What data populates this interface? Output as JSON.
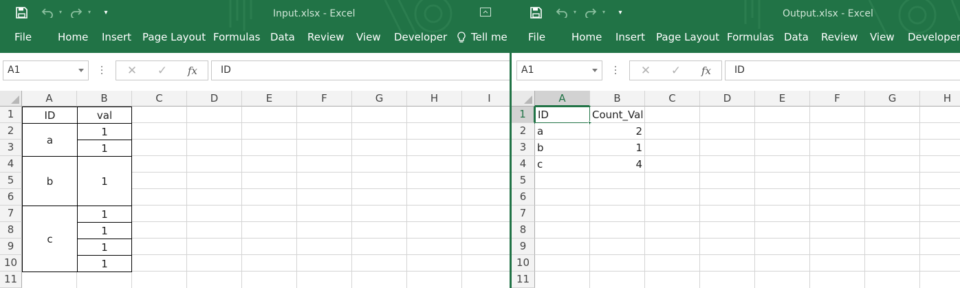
{
  "colors": {
    "ribbon": "#217346",
    "accent": "#217346"
  },
  "left": {
    "title": "Input.xlsx - Excel",
    "menu": [
      "File",
      "Home",
      "Insert",
      "Page Layout",
      "Formulas",
      "Data",
      "Review",
      "View",
      "Developer",
      "Tell me"
    ],
    "namebox": "A1",
    "formula": "ID",
    "fx": "fx",
    "columns": [
      "A",
      "B",
      "C",
      "D",
      "E",
      "F",
      "G",
      "H",
      "I"
    ],
    "rows": [
      "1",
      "2",
      "3",
      "4",
      "5",
      "6",
      "7",
      "8",
      "9",
      "10",
      "11"
    ],
    "cells": {
      "A1": "ID",
      "B1": "val",
      "A_a": "a",
      "B2": "1",
      "B3": "1",
      "A_b": "b",
      "B_b": "1",
      "A_c": "c",
      "B7": "1",
      "B8": "1",
      "B9": "1",
      "B10": "1"
    }
  },
  "right": {
    "title": "Output.xlsx - Excel",
    "menu": [
      "File",
      "Home",
      "Insert",
      "Page Layout",
      "Formulas",
      "Data",
      "Review",
      "View",
      "Developer"
    ],
    "namebox": "A1",
    "formula": "ID",
    "fx": "fx",
    "columns": [
      "A",
      "B",
      "C",
      "D",
      "E",
      "F",
      "G",
      "H"
    ],
    "rows": [
      "1",
      "2",
      "3",
      "4",
      "5",
      "6",
      "7",
      "8",
      "9",
      "10",
      "11"
    ],
    "table": [
      [
        "ID",
        "Count_Val"
      ],
      [
        "a",
        "2"
      ],
      [
        "b",
        "1"
      ],
      [
        "c",
        "4"
      ]
    ]
  }
}
